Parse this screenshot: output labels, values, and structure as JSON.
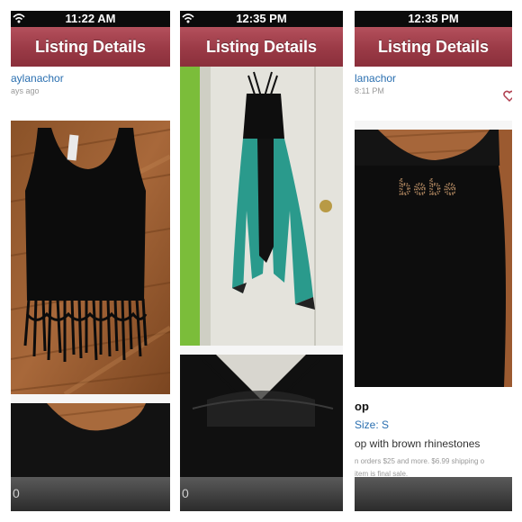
{
  "panels": [
    {
      "status_time": "11:22 AM",
      "nav_title": "Listing Details",
      "username": "aylanachor",
      "time_ago": "ays ago",
      "photos": [
        "black-fringe-tank-top-photo",
        "black-tank-back-photo"
      ]
    },
    {
      "status_time": "12:35 PM",
      "nav_title": "Listing Details",
      "photos": [
        "black-teal-high-low-dress-photo",
        "strappy-back-detail-photo"
      ]
    },
    {
      "status_time": "12:35 PM",
      "nav_title": "Listing Details",
      "username": "lanachor",
      "time_ago": "8:11 PM",
      "photo_text": "bebe",
      "item_title": "op",
      "size_label": "Size: S",
      "description": "op with brown rhinestones",
      "shipping_note": "n orders $25 and more. $6.99 shipping o",
      "final_note": "item is final sale."
    }
  ],
  "icons": {
    "wifi": "wifi-icon",
    "like": "heart-icon",
    "tab": "tab-bar-icon"
  },
  "colors": {
    "nav_bar": "#9a3a46",
    "username": "#2a6fb0",
    "status_bar": "#0b0b0b",
    "teal": "#2a9a8c"
  }
}
